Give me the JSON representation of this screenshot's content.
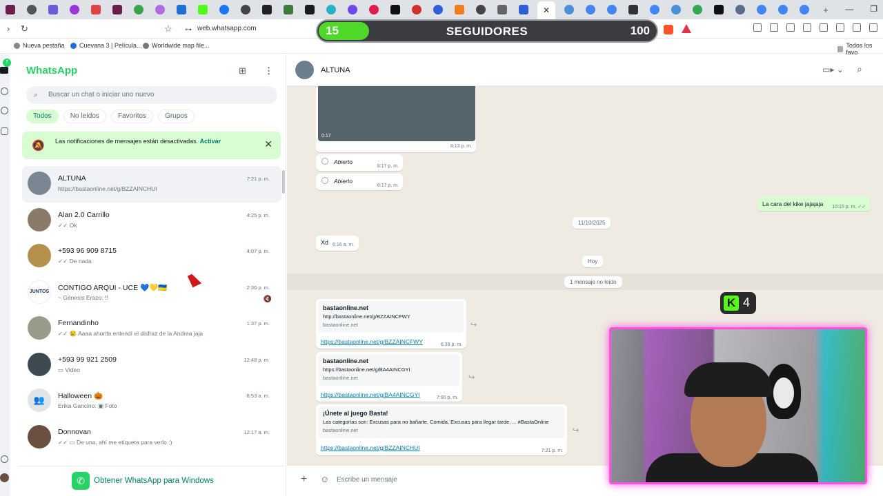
{
  "browser": {
    "url": "web.whatsapp.com",
    "tab_close": "✕",
    "bookmarks": [
      "Nueva pestaña",
      "Cuevana 3 | Película...",
      "Worldwide map file...",
      "Todos los favo"
    ]
  },
  "overlay": {
    "followers_count": "15",
    "followers_label": "SEGUIDORES",
    "followers_goal": "100",
    "followers_progress": 0.15,
    "kick_viewers": "4"
  },
  "sidebar": {
    "title": "WhatsApp",
    "search_placeholder": "Buscar un chat o iniciar uno nuevo",
    "filters": [
      "Todos",
      "No leídos",
      "Favoritos",
      "Grupos"
    ],
    "notif_text": "Las notificaciones de mensajes están desactivadas.",
    "notif_action": "Activar",
    "get_app": "Obtener WhatsApp para Windows",
    "rail_badge": "7",
    "chats": [
      {
        "name": "ALTUNA",
        "preview": "https://bastaonline.net/g/BZZAINCHUI",
        "time": "7:21 p. m.",
        "avatar": "#7a8793"
      },
      {
        "name": "Alan 2.0 Carrillo",
        "preview": "✓✓ Ok",
        "time": "4:25 p. m.",
        "avatar": "#8a7a6a"
      },
      {
        "name": "+593 96 909 8715",
        "preview": "✓✓ De nada",
        "time": "4:07 p. m.",
        "avatar": "#b5904c"
      },
      {
        "name": "CONTIGO ARQUI - UCE 💙💛🇺🇦",
        "preview": "~ Génesis Erazo: !!",
        "time": "2:36 p. m.",
        "avatar": "#ffffff"
      },
      {
        "name": "Fernandinho",
        "preview": "✓✓ 😢 Aaaa ahorita entendí el disfraz de la Andrea jaja",
        "time": "1:37 p. m.",
        "avatar": "#9a9a8a"
      },
      {
        "name": "+593 99 921 2509",
        "preview": "▭ Video",
        "time": "12:48 p. m.",
        "avatar": "#3d4a52"
      },
      {
        "name": "Halloween 🎃",
        "preview": "Erika Gancino: ▣ Foto",
        "time": "8:53 a. m.",
        "avatar": "#dfe5e7"
      },
      {
        "name": "Donnovan",
        "preview": "✓✓ ▭ De una, ahí me etiqueta para verlo :)",
        "time": "12:17 a. m.",
        "avatar": "#6a5040"
      }
    ]
  },
  "conversation": {
    "contact": "ALTUNA",
    "video_duration": "0:17",
    "video_time": "8:13 p. m.",
    "poll_option": "Abierto",
    "poll_time": "8:17 p. m.",
    "out_message": "La cara del kike jajajaja",
    "out_time": "10:15 p. m. ✓✓",
    "date_pill": "11/10/2025",
    "xd": "Xd",
    "xd_time": "6:16 a. m.",
    "today_pill": "Hoy",
    "unread_pill": "1 mensaje no leído",
    "link1": {
      "title": "bastaonline.net",
      "url": "http://bastaonline.net/g/BZZAINCFWY",
      "domain": "bastaonline.net",
      "link": "https://bastaonline.net/g/BZZAINCFWY",
      "time": "6:39 p. m."
    },
    "link2": {
      "title": "bastaonline.net",
      "url": "https://bastaonline.net/g/BA4AINCGYI",
      "domain": "bastaonline.net",
      "link": "https://bastaonline.net/g/BA4AINCGYI",
      "time": "7:00 p. m."
    },
    "link3": {
      "title": "¡Únete al juego Basta!",
      "url": "Las categorías son: Excusas para no bañarte, Comida, Excusas para llegar tarde, ... #BastaOnline",
      "domain": "bastaonline.net",
      "link": "https://bastaonline.net/g/BZZAINCHUI",
      "time": "7:21 p. m."
    },
    "composer_placeholder": "Escribe un mensaje"
  }
}
